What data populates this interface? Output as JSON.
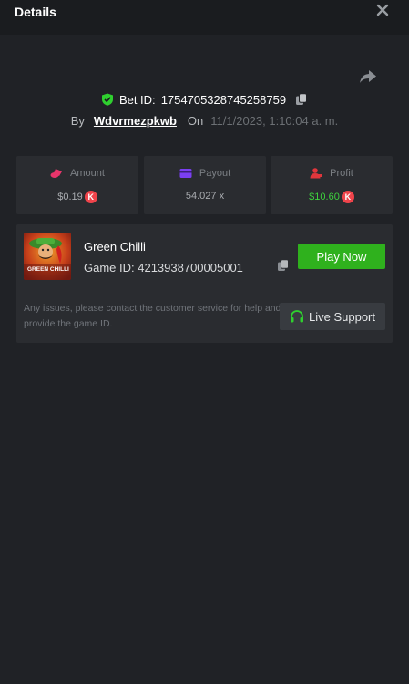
{
  "header": {
    "title": "Details"
  },
  "bet": {
    "id_label": "Bet ID:",
    "id_value": "1754705328745258759",
    "by_label": "By",
    "username": "Wdvrmezpkwb",
    "on_label": "On",
    "date": "11/1/2023, 1:10:04 a. m."
  },
  "stats": {
    "amount": {
      "label": "Amount",
      "value": "$0.19",
      "coin": "K"
    },
    "payout": {
      "label": "Payout",
      "value": "54.027 x"
    },
    "profit": {
      "label": "Profit",
      "value": "$10.60",
      "coin": "K"
    }
  },
  "game": {
    "name": "Green Chilli",
    "id_text": "Game ID: 4213938700005001",
    "thumb_text": "GREEN CHILLI",
    "play_label": "Play Now"
  },
  "support": {
    "notice": "Any issues, please contact the customer service for help and provide the game ID.",
    "button_label": "Live Support"
  },
  "colors": {
    "background": "#202226",
    "card": "#2a2c30",
    "accent_green": "#2fb11d",
    "profit_green": "#3dd23d",
    "coin_red": "#f0444b",
    "amount_pink": "#e8356b",
    "payout_purple": "#7b3ff2",
    "profit_red": "#e0363c"
  },
  "icons": {
    "close": "close-icon",
    "share": "share-icon",
    "verified": "shield-check-icon",
    "copy": "copy-icon",
    "amount": "coins-icon",
    "payout": "card-icon",
    "profit": "user-money-icon",
    "support": "headset-icon"
  }
}
